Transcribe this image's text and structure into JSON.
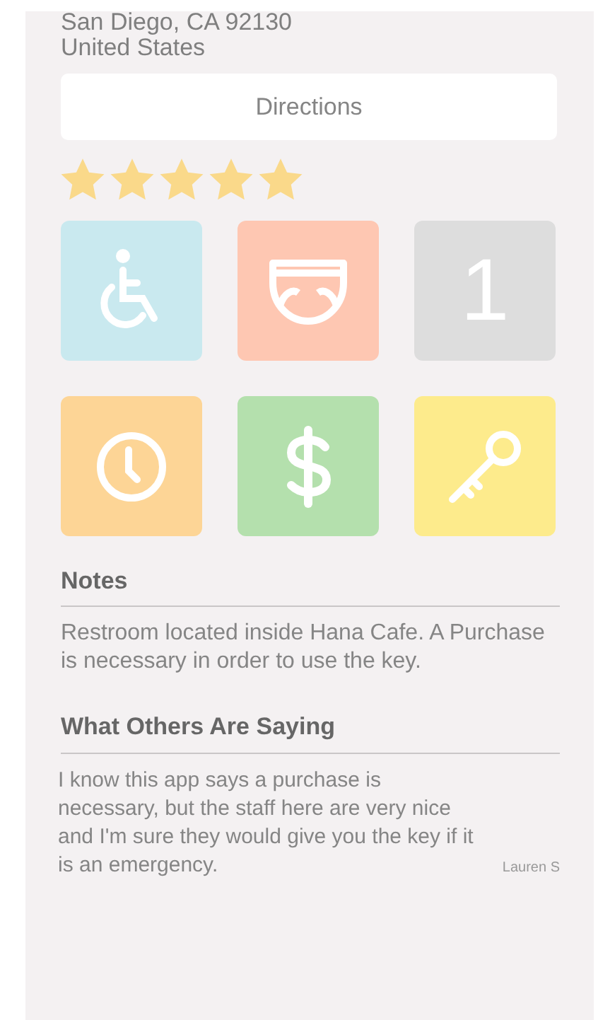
{
  "address": [
    "San Diego, CA 92130",
    "United States"
  ],
  "directions_button": "Directions",
  "rating": {
    "stars": 5
  },
  "amenities": [
    {
      "kind": "wheelchair",
      "color": "#c9e9ef"
    },
    {
      "kind": "diaper",
      "color": "#fec7b2"
    },
    {
      "kind": "number",
      "color": "#dddddd",
      "text": "1"
    },
    {
      "kind": "clock",
      "color": "#fdd596"
    },
    {
      "kind": "dollar",
      "color": "#b4e0ad"
    },
    {
      "kind": "key",
      "color": "#fdeb8c"
    }
  ],
  "notes": {
    "heading": "Notes",
    "text": "Restroom located inside Hana Cafe. A Purchase is necessary in order to use the key."
  },
  "reviews": {
    "heading": "What Others Are Saying",
    "items": [
      {
        "text": "I know this app says a purchase is necessary, but the staff here are very nice and I'm sure they would give you the key if it is an emergency.",
        "author": "Lauren S"
      }
    ]
  }
}
